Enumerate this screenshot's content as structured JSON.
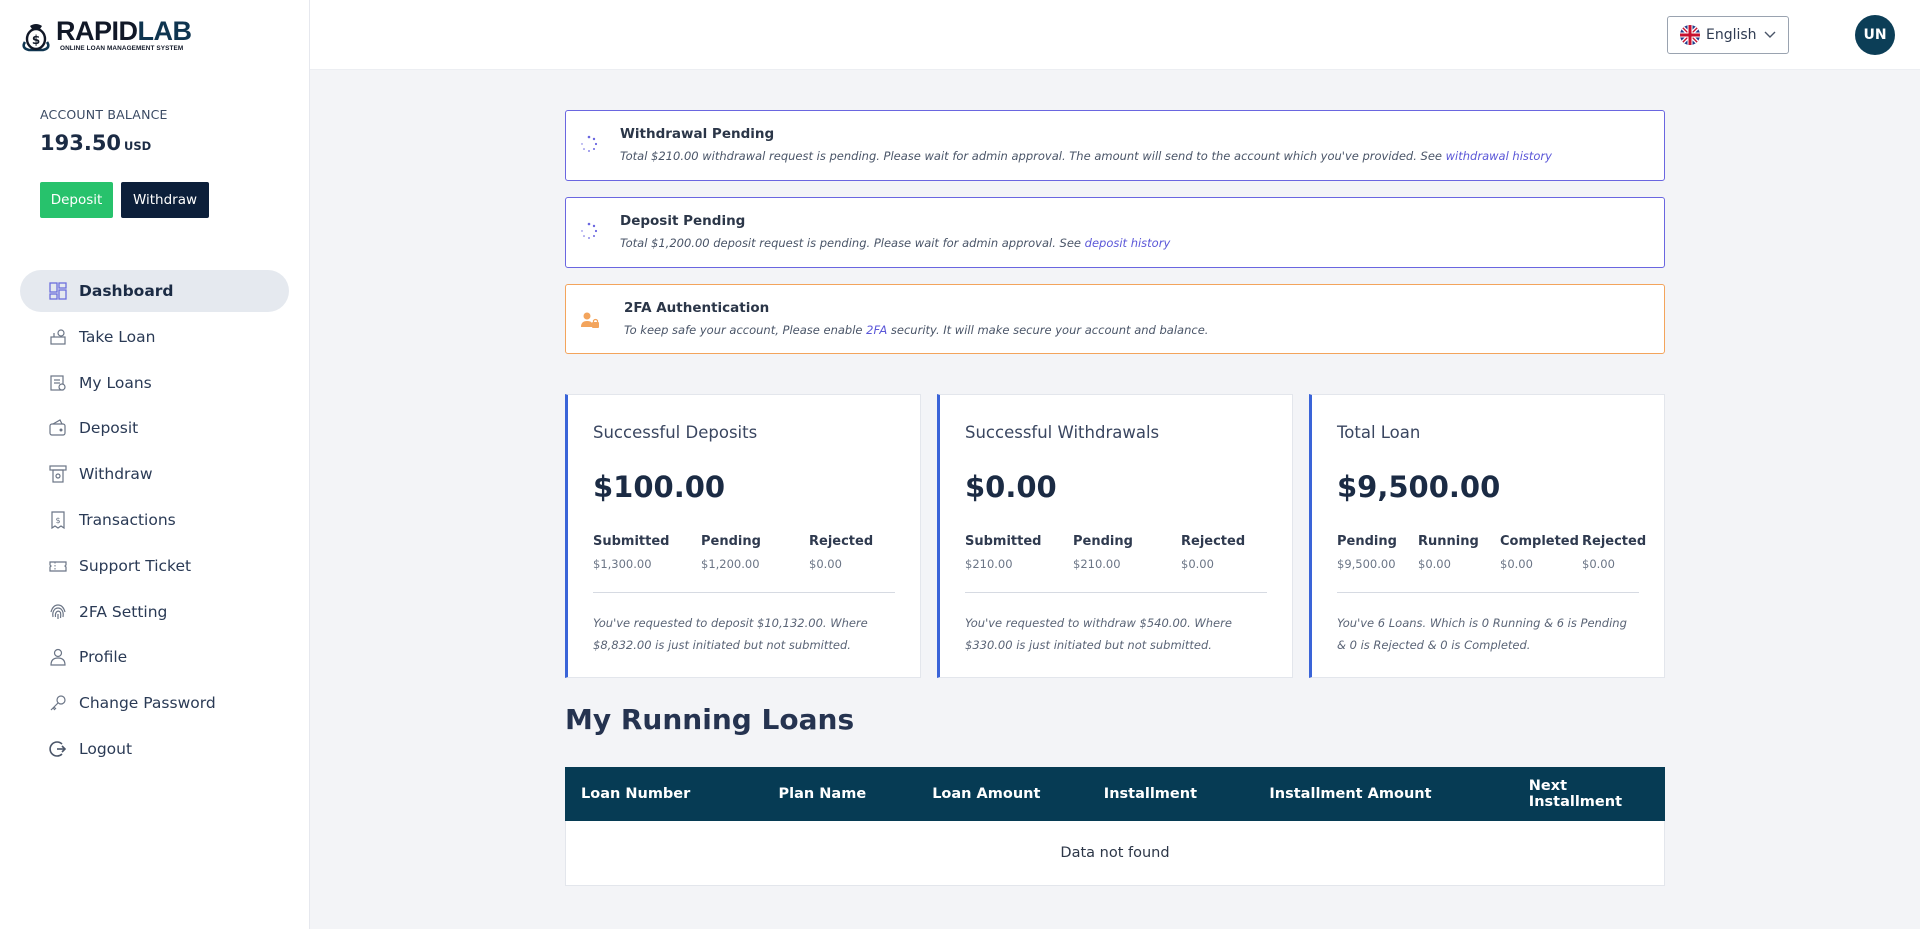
{
  "brand": {
    "name_part1": "RAPID",
    "name_part2": "LAB",
    "tagline": "ONLINE LOAN MANAGEMENT SYSTEM"
  },
  "account": {
    "label": "ACCOUNT BALANCE",
    "balance": "193.50",
    "currency": "USD",
    "deposit_label": "Deposit",
    "withdraw_label": "Withdraw"
  },
  "nav": [
    {
      "label": "Dashboard",
      "icon": "dashboard-icon",
      "active": true
    },
    {
      "label": "Take Loan",
      "icon": "take-loan-icon"
    },
    {
      "label": "My Loans",
      "icon": "my-loans-icon"
    },
    {
      "label": "Deposit",
      "icon": "deposit-icon"
    },
    {
      "label": "Withdraw",
      "icon": "withdraw-icon"
    },
    {
      "label": "Transactions",
      "icon": "transactions-icon"
    },
    {
      "label": "Support Ticket",
      "icon": "support-ticket-icon"
    },
    {
      "label": "2FA Setting",
      "icon": "fingerprint-icon"
    },
    {
      "label": "Profile",
      "icon": "user-icon"
    },
    {
      "label": "Change Password",
      "icon": "key-icon"
    },
    {
      "label": "Logout",
      "icon": "logout-icon"
    }
  ],
  "header": {
    "language": "English",
    "avatar_initials": "UN"
  },
  "alerts": {
    "withdrawal": {
      "title": "Withdrawal Pending",
      "text": "Total $210.00 withdrawal request is pending. Please wait for admin approval. The amount will send to the account which you've provided. See ",
      "link": "withdrawal history"
    },
    "deposit": {
      "title": "Deposit Pending",
      "text": "Total $1,200.00 deposit request is pending. Please wait for admin approval. See ",
      "link": "deposit history"
    },
    "twofa": {
      "title": "2FA Authentication",
      "text_before": "To keep safe your account, Please enable ",
      "link": "2FA",
      "text_after": " security. It will make secure your account and balance."
    }
  },
  "cards": {
    "deposits": {
      "title": "Successful Deposits",
      "amount": "$100.00",
      "stats": [
        {
          "label": "Submitted",
          "value": "$1,300.00"
        },
        {
          "label": "Pending",
          "value": "$1,200.00"
        },
        {
          "label": "Rejected",
          "value": "$0.00"
        }
      ],
      "note": "You've requested to deposit $10,132.00. Where $8,832.00 is just initiated but not submitted."
    },
    "withdrawals": {
      "title": "Successful Withdrawals",
      "amount": "$0.00",
      "stats": [
        {
          "label": "Submitted",
          "value": "$210.00"
        },
        {
          "label": "Pending",
          "value": "$210.00"
        },
        {
          "label": "Rejected",
          "value": "$0.00"
        }
      ],
      "note": "You've requested to withdraw $540.00. Where $330.00 is just initiated but not submitted."
    },
    "loans": {
      "title": "Total Loan",
      "amount": "$9,500.00",
      "stats": [
        {
          "label": "Pending",
          "value": "$9,500.00"
        },
        {
          "label": "Running",
          "value": "$0.00"
        },
        {
          "label": "Completed",
          "value": "$0.00"
        },
        {
          "label": "Rejected",
          "value": "$0.00"
        }
      ],
      "note": "You've 6 Loans. Which is 0 Running & 6 is Pending & 0 is Rejected & 0 is Completed."
    }
  },
  "running_loans": {
    "title": "My Running Loans",
    "columns": [
      "Loan Number",
      "Plan Name",
      "Loan Amount",
      "Installment",
      "Installment Amount",
      "Next Installment"
    ],
    "empty_text": "Data not found"
  },
  "colors": {
    "primary_dark": "#063b54",
    "success": "#27c26c",
    "alert_border": "#6a66e0",
    "warn_border": "#f3a45c",
    "card_accent": "#3a64d8"
  }
}
